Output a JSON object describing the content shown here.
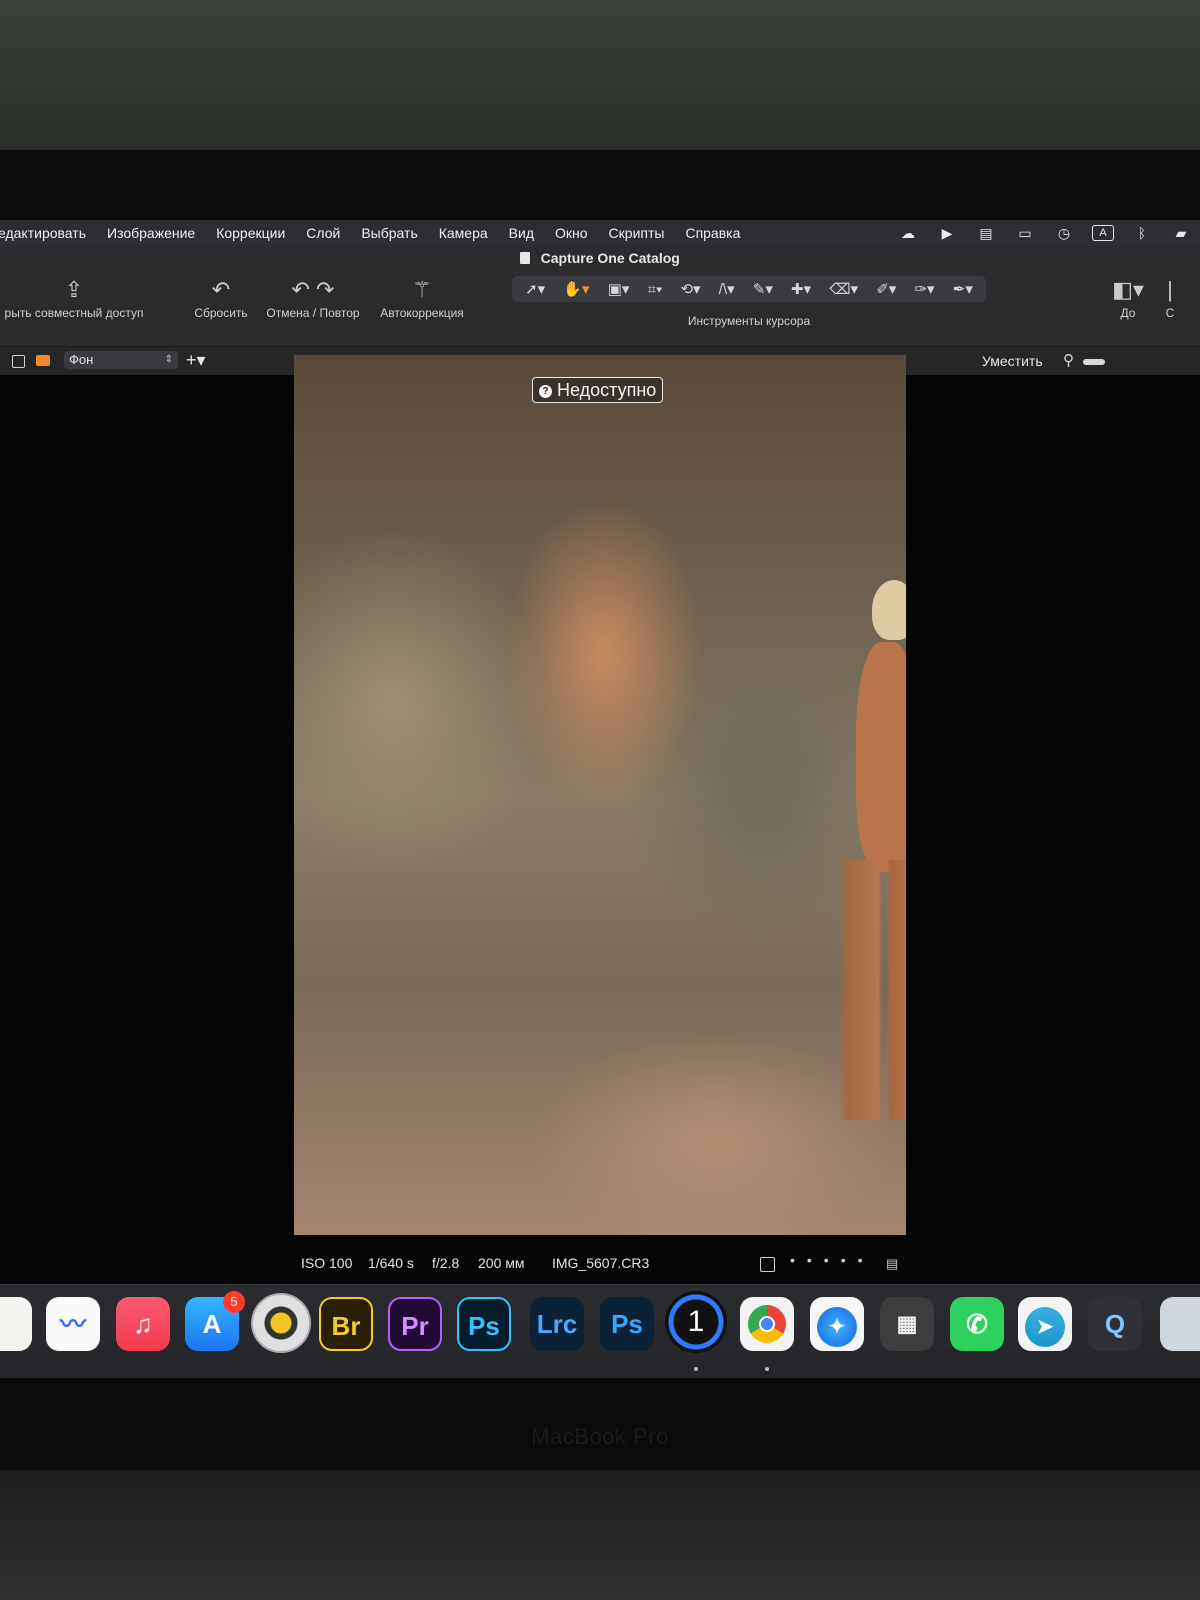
{
  "menu": {
    "items": [
      "едактировать",
      "Изображение",
      "Коррекции",
      "Слой",
      "Выбрать",
      "Камера",
      "Вид",
      "Окно",
      "Скрипты",
      "Справка"
    ]
  },
  "status_icons": [
    "creative-cloud-icon",
    "play-icon",
    "drive-icon",
    "display-icon",
    "time-machine-icon",
    "keyboard-input-icon",
    "bluetooth-icon",
    "battery-icon"
  ],
  "status_input_label": "A",
  "window": {
    "title": "Capture One Catalog"
  },
  "toolbar": {
    "share_label": "рыть совместный доступ",
    "reset_label": "Сбросить",
    "undo_redo_label": "Отмена / Повтор",
    "autocorrect_label": "Автокоррекция",
    "cursor_tools_label": "Инструменты курсора",
    "before_label": "До",
    "cut_label": "С"
  },
  "layers": {
    "selected_layer": "Фон",
    "fit_label": "Уместить"
  },
  "viewer": {
    "unavailable_label": "Недоступно"
  },
  "metadata": {
    "iso": "ISO 100",
    "shutter": "1/640 s",
    "aperture": "f/2.8",
    "focal": "200 мм",
    "filename": "IMG_5607.CR3"
  },
  "dock": {
    "br": "Br",
    "pr": "Pr",
    "ps": "Ps",
    "lrc": "Lrc",
    "ps2": "Ps",
    "one": "1",
    "appstore_badge": "5"
  },
  "device": {
    "brand": "MacBook Pro"
  }
}
